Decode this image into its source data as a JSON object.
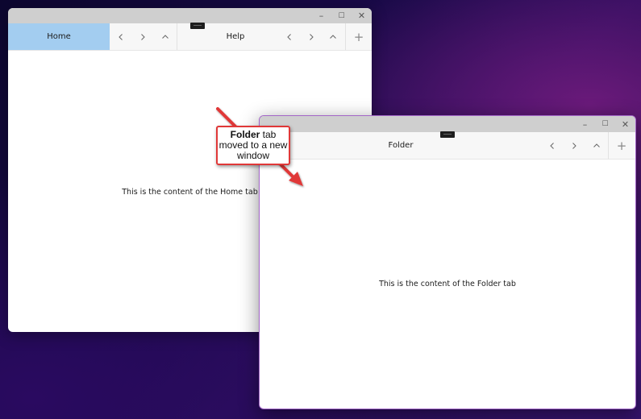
{
  "window1": {
    "caption": {
      "minimize_glyph": "–",
      "maximize_glyph": "☐",
      "close_glyph": "✕"
    },
    "tabs": [
      {
        "label": "Home",
        "selected": true
      },
      {
        "label": "Help",
        "selected": false
      }
    ],
    "add_glyph": "+",
    "content_text": "This is the content of the Home tab"
  },
  "window2": {
    "caption": {
      "minimize_glyph": "–",
      "maximize_glyph": "☐",
      "close_glyph": "✕"
    },
    "tabs": [
      {
        "label": "Folder",
        "selected": false
      }
    ],
    "add_glyph": "+",
    "content_text": "This is the content of the Folder tab"
  },
  "annotation": {
    "bold": "Folder",
    "rest1": " tab",
    "line2": "moved to a new",
    "line3": "window"
  },
  "colors": {
    "selected_tab": "#a3cdf0",
    "annotation_red": "#e03838",
    "window_border": "#a366c8"
  },
  "icons": [
    "chevron-left-icon",
    "chevron-right-icon",
    "chevron-up-icon",
    "plus-icon",
    "minimize-icon",
    "maximize-icon",
    "close-icon",
    "drag-grip-icon"
  ]
}
